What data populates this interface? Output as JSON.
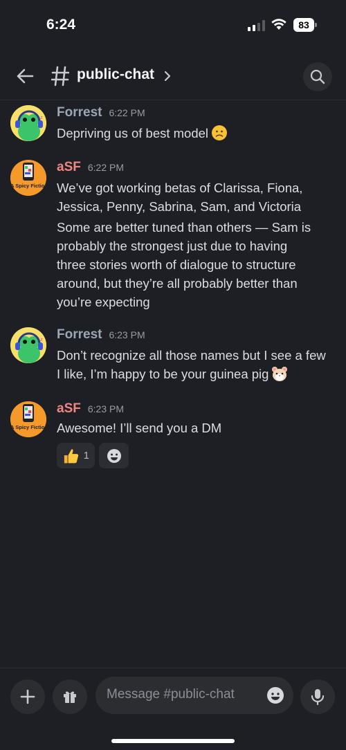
{
  "status_bar": {
    "time": "6:24",
    "battery": "83"
  },
  "header": {
    "back_icon": "arrow-left-icon",
    "channel_icon": "hash-icon",
    "channel_name": "public-chat",
    "chevron_icon": "chevron-right-icon",
    "search_icon": "search-icon"
  },
  "messages": [
    {
      "author": "Forrest",
      "time": "6:22 PM",
      "lines": [
        "Depriving us of best model"
      ],
      "emoji": "frowning-face"
    },
    {
      "author": "aSF",
      "time": "6:22 PM",
      "avatar_text": "A Spicy Fiction",
      "lines": [
        "We’ve got working betas of Clarissa, Fiona,",
        "Jessica, Penny, Sabrina, Sam, and Victoria"
      ],
      "lines2": [
        "Some are better tuned than others — Sam is",
        "probably the strongest just due to having",
        "three stories worth of dialogue to structure",
        "around, but they’re all probably better than",
        "you’re expecting"
      ]
    },
    {
      "author": "Forrest",
      "time": "6:23 PM",
      "lines": [
        "Don’t recognize all those names but I see a few",
        "I like, I’m happy to be your guinea pig"
      ],
      "emoji": "hamster-face"
    },
    {
      "author": "aSF",
      "time": "6:23 PM",
      "avatar_text": "A Spicy Fiction",
      "lines": [
        "Awesome! I’ll send you a DM"
      ],
      "reactions": [
        {
          "emoji": "thumbs-up",
          "count": "1"
        },
        {
          "emoji": "add-reaction"
        }
      ]
    }
  ],
  "composer": {
    "placeholder": "Message #public-chat",
    "plus_icon": "plus-icon",
    "gift_icon": "gift-icon",
    "emoji_icon": "emoji-icon",
    "mic_icon": "microphone-icon"
  },
  "colors": {
    "background": "#1e1f24",
    "forrest_name": "#9aa7b4",
    "asf_name": "#f0867f"
  }
}
